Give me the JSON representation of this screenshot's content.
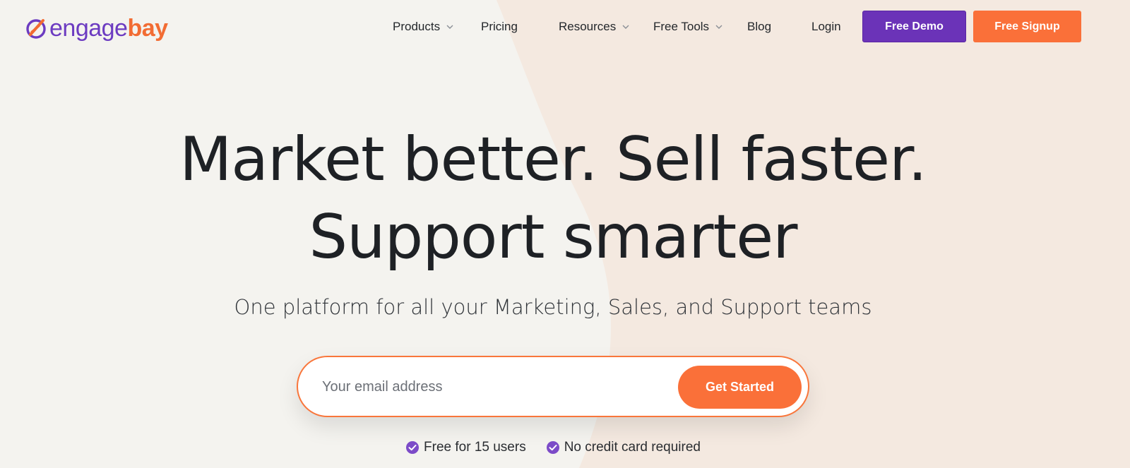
{
  "brand": {
    "logo_part1": "engage",
    "logo_part2": "bay",
    "primary_color": "#6b33b8",
    "accent_color": "#fa7039"
  },
  "nav": {
    "products": "Products",
    "pricing": "Pricing",
    "resources": "Resources",
    "free_tools": "Free Tools",
    "blog": "Blog",
    "login": "Login",
    "free_demo": "Free Demo",
    "free_signup": "Free Signup"
  },
  "hero": {
    "line1": "Market better. Sell faster.",
    "line2": "Support smarter",
    "subtitle": "One platform for all your Marketing, Sales, and Support teams"
  },
  "signup": {
    "placeholder": "Your email address",
    "value": "",
    "cta": "Get Started"
  },
  "benefits": [
    {
      "text": "Free for 15 users",
      "icon": "check-circle-icon"
    },
    {
      "text": "No credit card required",
      "icon": "check-circle-icon"
    }
  ]
}
